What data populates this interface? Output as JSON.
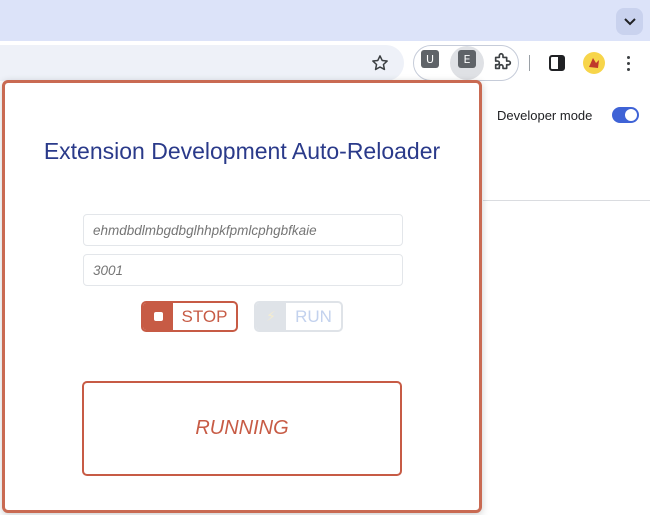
{
  "browser": {
    "extensions": [
      "U",
      "E"
    ],
    "icons": {
      "tab_search": "chevron-down-icon",
      "bookmark": "star-icon",
      "extensions_menu": "puzzle-icon",
      "side_panel": "side-panel-icon",
      "profile": "avatar-icon",
      "menu": "kebab-menu-icon"
    }
  },
  "page": {
    "developer_mode_label": "Developer mode",
    "developer_mode_on": true
  },
  "popup": {
    "title": "Extension Development Auto-Reloader",
    "extension_id_placeholder": "ehmdbdlmbgdbglhhpkfpmlcphgbfkaie",
    "port_placeholder": "3001",
    "stop_label": "STOP",
    "run_label": "RUN",
    "run_icon": "⚡",
    "status": "RUNNING"
  },
  "colors": {
    "accent": "#c75b45",
    "title": "#2a3a8a",
    "toggle": "#3f63d6",
    "tabstrip": "#dce3f9"
  }
}
